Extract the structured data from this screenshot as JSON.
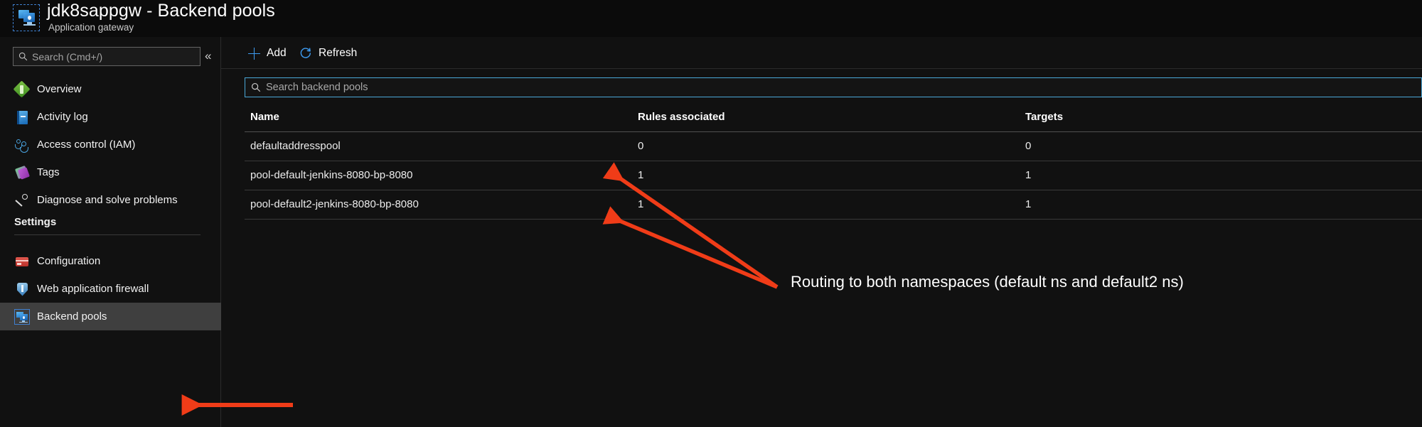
{
  "header": {
    "title": "jdk8sappgw - Backend pools",
    "subtitle": "Application gateway",
    "icon": "app-gateway-icon"
  },
  "sidebar": {
    "search": {
      "placeholder": "Search (Cmd+/)",
      "value": "",
      "icon": "search-icon"
    },
    "collapse_icon": "«",
    "items": [
      {
        "label": "Overview",
        "icon": "overview-icon",
        "selected": false
      },
      {
        "label": "Activity log",
        "icon": "activity-log-icon",
        "selected": false
      },
      {
        "label": "Access control (IAM)",
        "icon": "access-control-icon",
        "selected": false
      },
      {
        "label": "Tags",
        "icon": "tags-icon",
        "selected": false
      },
      {
        "label": "Diagnose and solve problems",
        "icon": "wrench-icon",
        "selected": false
      }
    ],
    "settings_header": "Settings",
    "settings_items": [
      {
        "label": "Configuration",
        "icon": "configuration-icon",
        "selected": false
      },
      {
        "label": "Web application firewall",
        "icon": "shield-icon",
        "selected": false
      },
      {
        "label": "Backend pools",
        "icon": "backend-pools-icon",
        "selected": true
      }
    ]
  },
  "toolbar": {
    "add_label": "Add",
    "add_icon": "plus-icon",
    "refresh_label": "Refresh",
    "refresh_icon": "refresh-icon"
  },
  "main": {
    "search": {
      "placeholder": "Search backend pools",
      "value": "",
      "icon": "search-icon"
    },
    "table": {
      "columns": [
        "Name",
        "Rules associated",
        "Targets"
      ],
      "rows": [
        {
          "name": "defaultaddresspool",
          "rules": "0",
          "targets": "0"
        },
        {
          "name": "pool-default-jenkins-8080-bp-8080",
          "rules": "1",
          "targets": "1"
        },
        {
          "name": "pool-default2-jenkins-8080-bp-8080",
          "rules": "1",
          "targets": "1"
        }
      ]
    }
  },
  "annotations": {
    "note_text": "Routing to both namespaces (default ns and default2 ns)",
    "arrow_color": "#f03c18"
  }
}
